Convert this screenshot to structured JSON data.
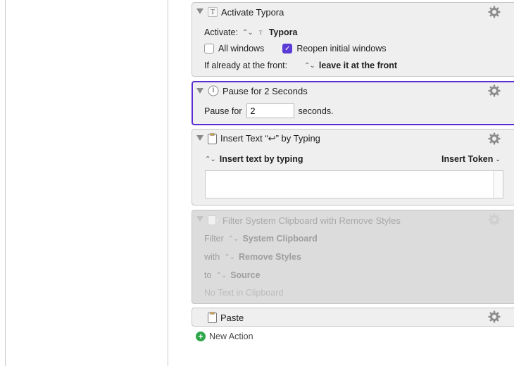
{
  "actions": {
    "activate": {
      "title": "Activate Typora",
      "activate_label": "Activate:",
      "app_name": "Typora",
      "all_windows_label": "All windows",
      "reopen_label": "Reopen initial windows",
      "front_label": "If already at the front:",
      "front_value": "leave it at the front"
    },
    "pause": {
      "title": "Pause for 2 Seconds",
      "label_before": "Pause for",
      "value": "2",
      "label_after": "seconds."
    },
    "insert_text": {
      "title": "Insert Text “↩” by Typing",
      "mode": "Insert text by typing",
      "token_label": "Insert Token"
    },
    "filter": {
      "title": "Filter System Clipboard with Remove Styles",
      "filter_label": "Filter",
      "filter_value": "System Clipboard",
      "with_label": "with",
      "with_value": "Remove Styles",
      "to_label": "to",
      "to_value": "Source",
      "status": "No Text in Clipboard"
    },
    "paste": {
      "title": "Paste"
    }
  },
  "new_action_label": "New Action",
  "colors": {
    "selection_border": "#5b2bd3",
    "checkbox_on": "#5b3bd6",
    "add_green": "#2fa64a"
  }
}
